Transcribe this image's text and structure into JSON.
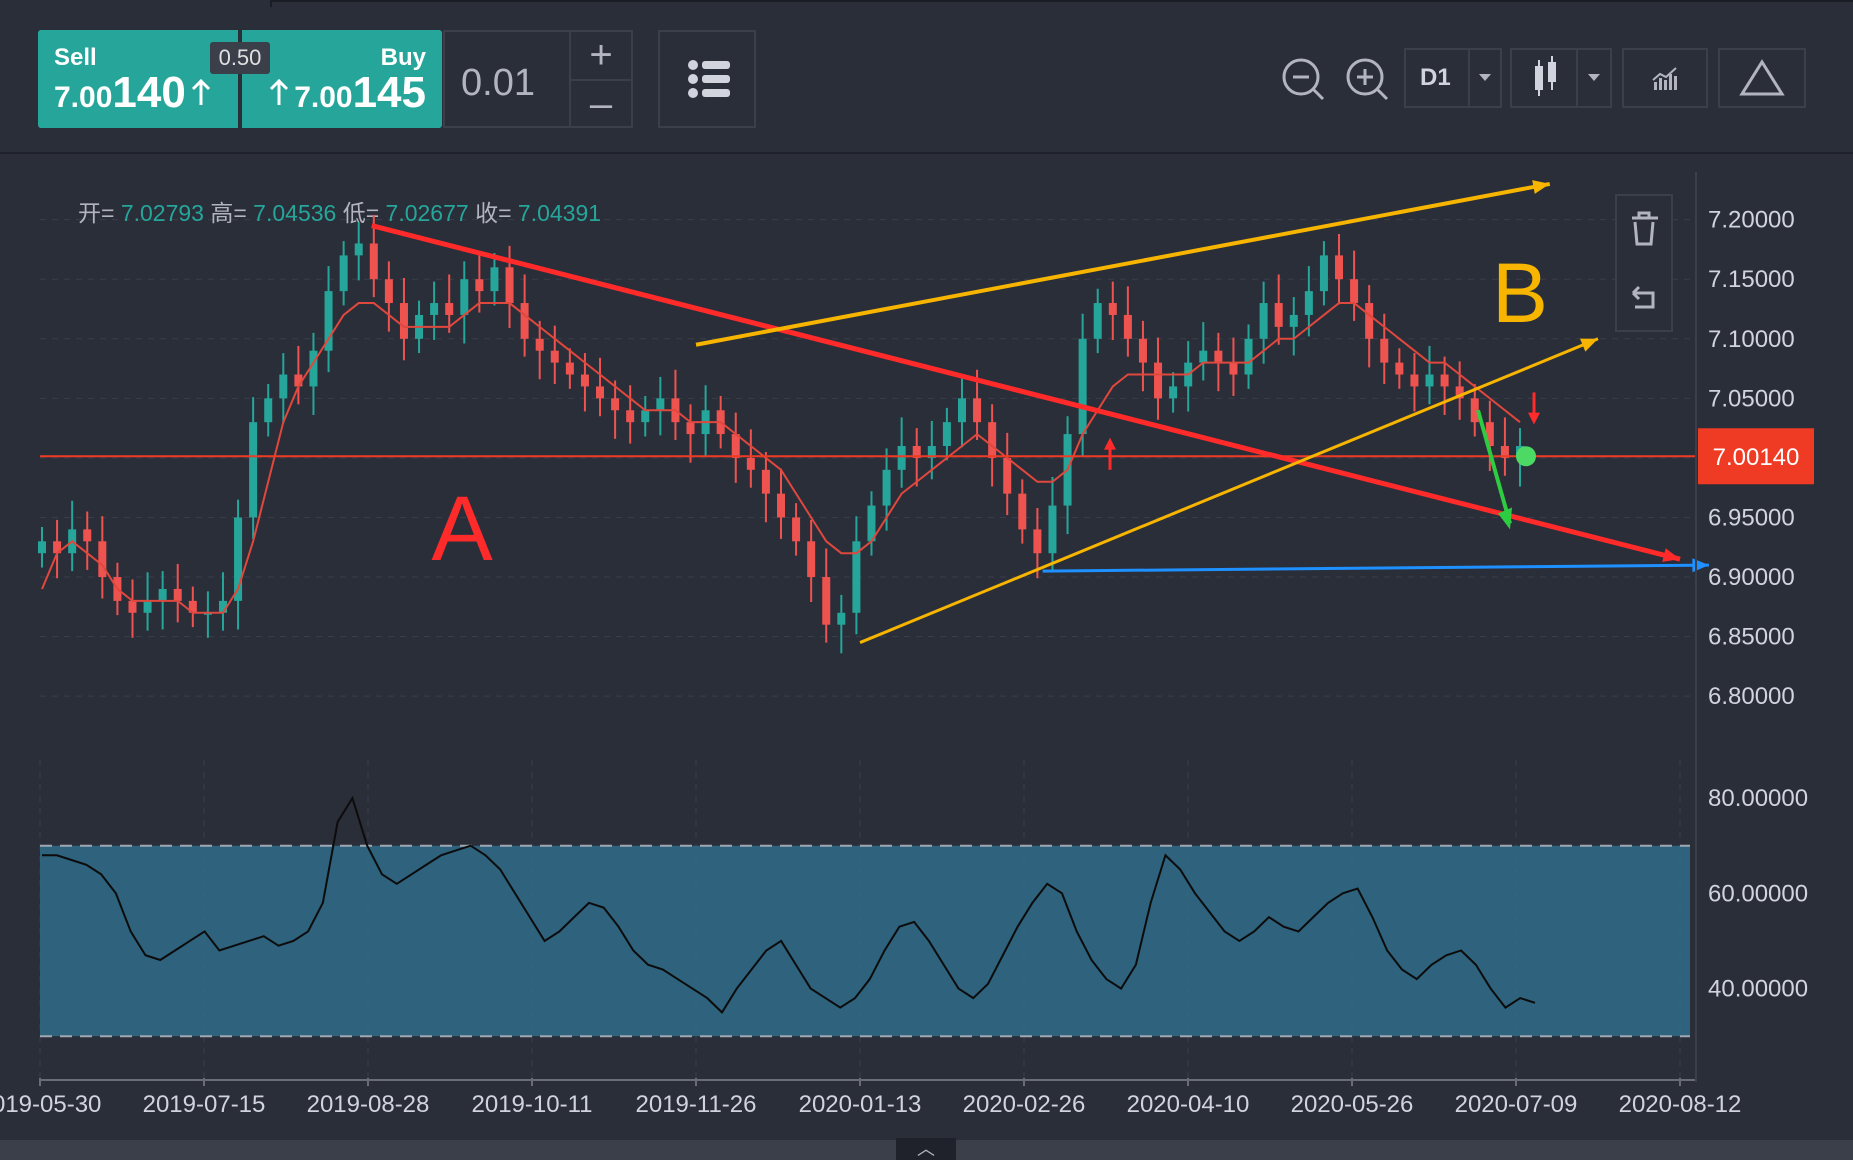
{
  "toolbar": {
    "sell_label": "Sell",
    "sell_price_prefix": "7.00",
    "sell_price_main": "140",
    "buy_label": "Buy",
    "buy_price_prefix": "7.00",
    "buy_price_main": "145",
    "spread": "0.50",
    "lot_size": "0.01",
    "plus_icon": "+",
    "minus_icon": "–",
    "timeframe": "D1",
    "icons": [
      "zoom-out-icon",
      "zoom-in-icon",
      "candlestick-icon",
      "indicators-icon",
      "drawing-triangle-icon",
      "list-icon",
      "trash-icon",
      "undo-icon"
    ]
  },
  "ohlc": {
    "open_label": "开=",
    "open": "7.02793",
    "high_label": "高=",
    "high": "7.04536",
    "low_label": "低=",
    "low": "7.02677",
    "close_label": "收=",
    "close": "7.04391"
  },
  "annotations": {
    "a": "A",
    "b": "B"
  },
  "colors": {
    "background": "#2a2e39",
    "up": "#26a69a",
    "down": "#ef5350",
    "current_price": "#ef3b24",
    "ma": "#e0473d",
    "trend_red": "#ff2a2a",
    "trend_yellow": "#f7b500",
    "support_blue": "#1e90ff",
    "rsi_band": "#2f6f8f"
  },
  "chart_data": [
    {
      "type": "line",
      "series_kind": "candlestick",
      "symbol_price_label": "7.00140",
      "y_tick_labels": [
        "7.20000",
        "7.15000",
        "7.10000",
        "7.05000",
        "7.00000",
        "6.95000",
        "6.90000",
        "6.85000",
        "6.80000"
      ],
      "x_tick_labels": [
        "2019-05-30",
        "2019-07-15",
        "2019-08-28",
        "2019-10-11",
        "2019-11-26",
        "2020-01-13",
        "2020-02-26",
        "2020-04-10",
        "2020-05-26",
        "2020-07-09",
        "2020-08-12"
      ],
      "ylim": [
        6.78,
        7.24
      ],
      "current_price": 7.0014,
      "grid": true,
      "series": [
        {
          "values": [
            6.93,
            6.92,
            6.94,
            6.93,
            6.9,
            6.88,
            6.87,
            6.88,
            6.89,
            6.88,
            6.87,
            6.87,
            6.88,
            6.95,
            7.03,
            7.05,
            7.07,
            7.06,
            7.09,
            7.14,
            7.17,
            7.18,
            7.15,
            7.13,
            7.1,
            7.12,
            7.13,
            7.12,
            7.15,
            7.14,
            7.16,
            7.13,
            7.1,
            7.09,
            7.08,
            7.07,
            7.06,
            7.05,
            7.04,
            7.03,
            7.04,
            7.05,
            7.03,
            7.02,
            7.04,
            7.02,
            7.0,
            6.99,
            6.97,
            6.95,
            6.93,
            6.9,
            6.86,
            6.87,
            6.93,
            6.96,
            6.99,
            7.01,
            7.0,
            7.01,
            7.03,
            7.05,
            7.03,
            7.0,
            6.97,
            6.94,
            6.92,
            6.96,
            7.02,
            7.1,
            7.13,
            7.12,
            7.1,
            7.08,
            7.05,
            7.06,
            7.08,
            7.09,
            7.08,
            7.07,
            7.1,
            7.13,
            7.11,
            7.12,
            7.14,
            7.17,
            7.15,
            7.13,
            7.1,
            7.08,
            7.07,
            7.06,
            7.07,
            7.06,
            7.05,
            7.03,
            7.01,
            7.0,
            7.01
          ],
          "ma_values": [
            6.89,
            6.92,
            6.93,
            6.92,
            6.91,
            6.89,
            6.88,
            6.88,
            6.88,
            6.88,
            6.87,
            6.87,
            6.87,
            6.89,
            6.93,
            6.98,
            7.03,
            7.06,
            7.08,
            7.1,
            7.12,
            7.13,
            7.13,
            7.12,
            7.11,
            7.11,
            7.11,
            7.11,
            7.12,
            7.13,
            7.13,
            7.13,
            7.12,
            7.11,
            7.1,
            7.09,
            7.08,
            7.07,
            7.06,
            7.05,
            7.04,
            7.04,
            7.04,
            7.03,
            7.03,
            7.03,
            7.02,
            7.01,
            7.0,
            6.99,
            6.97,
            6.95,
            6.93,
            6.92,
            6.92,
            6.93,
            6.95,
            6.97,
            6.98,
            6.99,
            7.0,
            7.01,
            7.02,
            7.01,
            7.0,
            6.99,
            6.98,
            6.98,
            6.99,
            7.02,
            7.04,
            7.06,
            7.07,
            7.07,
            7.07,
            7.07,
            7.07,
            7.08,
            7.08,
            7.08,
            7.08,
            7.09,
            7.1,
            7.1,
            7.11,
            7.12,
            7.13,
            7.13,
            7.12,
            7.11,
            7.1,
            7.09,
            7.08,
            7.08,
            7.07,
            7.06,
            7.05,
            7.04,
            7.03
          ]
        }
      ],
      "trendlines": [
        {
          "name": "resistance-A",
          "color": "red",
          "from": [
            "2019-08-29",
            7.195
          ],
          "to": [
            "2020-08-12",
            6.915
          ]
        },
        {
          "name": "channel-upper",
          "color": "yellow",
          "from": [
            "2019-11-26",
            7.095
          ],
          "to": [
            "2020-07-16",
            7.23
          ]
        },
        {
          "name": "channel-lower",
          "color": "yellow",
          "from": [
            "2020-01-13",
            6.845
          ],
          "to": [
            "2020-07-26",
            7.1
          ]
        },
        {
          "name": "support-line",
          "color": "blue",
          "from": [
            "2020-03-02",
            6.905
          ],
          "to": [
            "2020-08-18",
            6.91
          ]
        }
      ]
    },
    {
      "type": "line",
      "series_kind": "rsi",
      "y_tick_labels": [
        "80.00000",
        "60.00000",
        "40.00000"
      ],
      "ylim": [
        25,
        88
      ],
      "band": [
        30,
        70
      ],
      "grid": true,
      "series": [
        {
          "values": [
            68,
            68,
            67,
            66,
            64,
            60,
            52,
            47,
            46,
            48,
            50,
            52,
            48,
            49,
            50,
            51,
            49,
            50,
            52,
            58,
            75,
            80,
            70,
            64,
            62,
            64,
            66,
            68,
            69,
            70,
            68,
            65,
            60,
            55,
            50,
            52,
            55,
            58,
            57,
            53,
            48,
            45,
            44,
            42,
            40,
            38,
            35,
            40,
            44,
            48,
            50,
            45,
            40,
            38,
            36,
            38,
            42,
            48,
            53,
            54,
            50,
            45,
            40,
            38,
            41,
            47,
            53,
            58,
            62,
            60,
            52,
            46,
            42,
            40,
            45,
            58,
            68,
            65,
            60,
            56,
            52,
            50,
            52,
            55,
            53,
            52,
            55,
            58,
            60,
            61,
            55,
            48,
            44,
            42,
            45,
            47,
            48,
            45,
            40,
            36,
            38,
            37
          ]
        }
      ]
    }
  ]
}
